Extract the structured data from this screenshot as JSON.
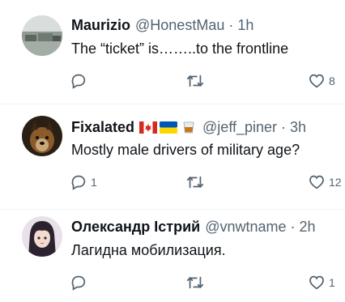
{
  "tweets": [
    {
      "name": "Maurizio",
      "handle": "@HonestMau",
      "time": "1h",
      "text": "The “ticket” is……..to the frontline",
      "replies": "",
      "retweets": "",
      "likes": "8"
    },
    {
      "name": "Fixalated",
      "flags": [
        "canada-flag",
        "ukraine-flag",
        "whiskey-glass-emoji"
      ],
      "handle": "@jeff_piner",
      "time": "3h",
      "text": "Mostly male drivers of military age?",
      "replies": "1",
      "retweets": "",
      "likes": "12"
    },
    {
      "name": "Олександр Істрий",
      "handle": "@vnwtname",
      "time": "2h",
      "text": "Лагидна мобилизация.",
      "replies": "",
      "retweets": "",
      "likes": "1"
    }
  ],
  "separator": "·",
  "colors": {
    "text": "#0f1419",
    "muted": "#536471",
    "divider": "#eff3f4"
  }
}
